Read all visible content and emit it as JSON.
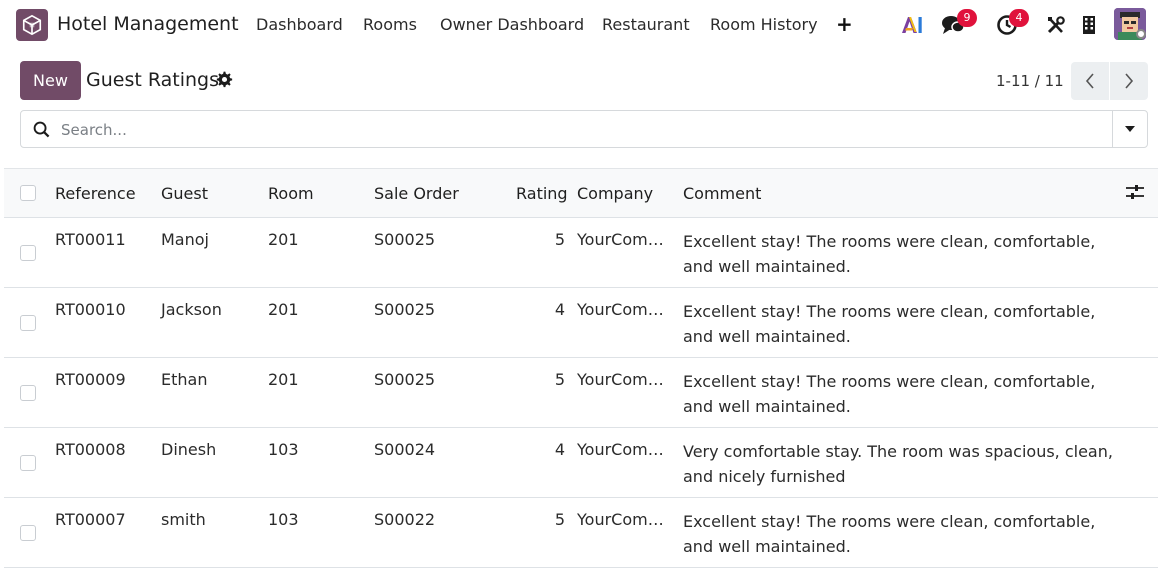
{
  "app": {
    "title": "Hotel Management",
    "icon": "cube-icon",
    "accent": "#714B67"
  },
  "nav": [
    {
      "label": "Dashboard"
    },
    {
      "label": "Rooms"
    },
    {
      "label": "Owner Dashboard"
    },
    {
      "label": "Restaurant"
    },
    {
      "label": "Room History"
    }
  ],
  "systray": {
    "messages_count": "9",
    "activities_count": "4"
  },
  "control": {
    "new_label": "New",
    "title": "Guest Ratings",
    "pager": "1-11 / 11"
  },
  "search": {
    "placeholder": "Search..."
  },
  "table": {
    "headers": {
      "reference": "Reference",
      "guest": "Guest",
      "room": "Room",
      "sale_order": "Sale Order",
      "rating": "Rating",
      "company": "Company",
      "comment": "Comment"
    },
    "rows": [
      {
        "reference": "RT00011",
        "guest": "Manoj",
        "room": "201",
        "sale_order": "S00025",
        "rating": "5",
        "company": "YourCom…",
        "comment": "Excellent stay! The rooms were clean, comfortable, and well maintained."
      },
      {
        "reference": "RT00010",
        "guest": "Jackson",
        "room": "201",
        "sale_order": "S00025",
        "rating": "4",
        "company": "YourCom…",
        "comment": "Excellent stay! The rooms were clean, comfortable, and well maintained."
      },
      {
        "reference": "RT00009",
        "guest": "Ethan",
        "room": "201",
        "sale_order": "S00025",
        "rating": "5",
        "company": "YourCom…",
        "comment": "Excellent stay! The rooms were clean, comfortable, and well maintained."
      },
      {
        "reference": "RT00008",
        "guest": "Dinesh",
        "room": "103",
        "sale_order": "S00024",
        "rating": "4",
        "company": "YourCom…",
        "comment": "Very comfortable stay. The room was spacious, clean, and nicely furnished"
      },
      {
        "reference": "RT00007",
        "guest": "smith",
        "room": "103",
        "sale_order": "S00022",
        "rating": "5",
        "company": "YourCom…",
        "comment": "Excellent stay! The rooms were clean, comfortable, and well maintained."
      }
    ]
  }
}
